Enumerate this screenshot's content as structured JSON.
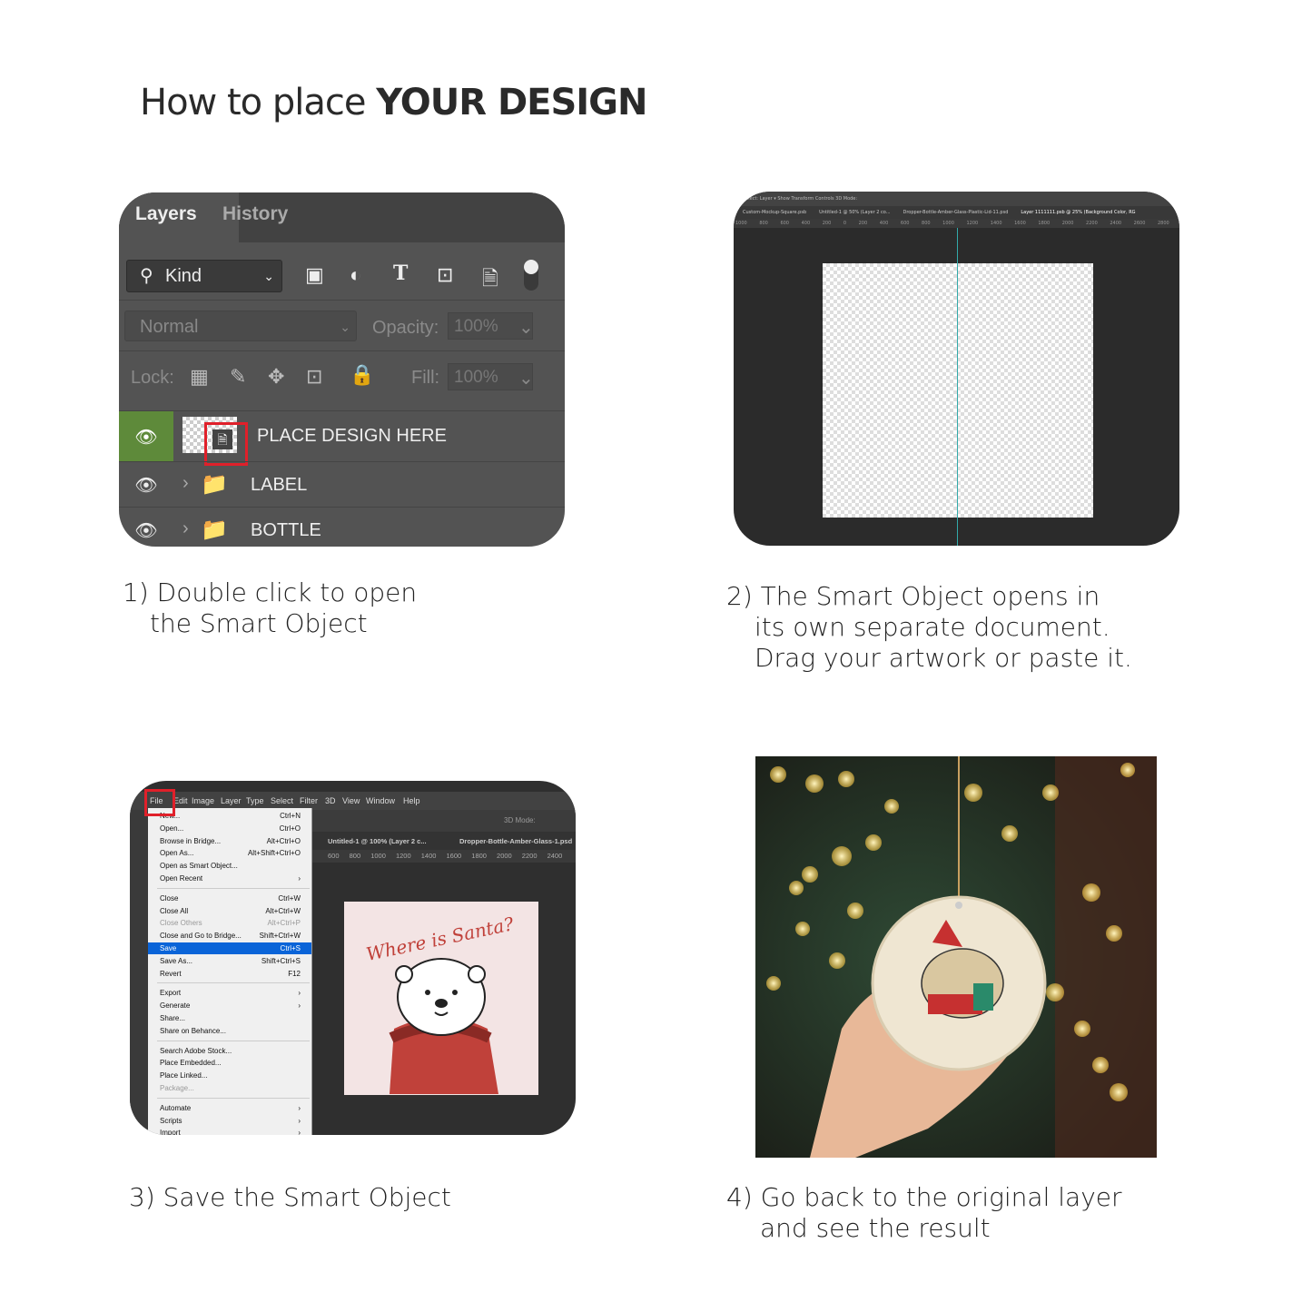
{
  "title": {
    "prefix": "How to place ",
    "emphasis": "YOUR DESIGN"
  },
  "steps": [
    {
      "lines": [
        "1) Double click to open",
        "the Smart Object"
      ]
    },
    {
      "lines": [
        "2) The Smart Object opens in",
        "its own separate document.",
        "Drag your artwork or paste it."
      ]
    },
    {
      "lines": [
        "3) Save the Smart Object"
      ]
    },
    {
      "lines": [
        "4) Go back to the original layer",
        "and see the result"
      ]
    }
  ],
  "layers_panel": {
    "tabs": [
      "Layers",
      "History"
    ],
    "filter_kind": "Kind",
    "blend_mode": "Normal",
    "opacity_label": "Opacity:",
    "opacity_value": "100%",
    "lock_label": "Lock:",
    "fill_label": "Fill:",
    "fill_value": "100%",
    "layers": [
      {
        "name": "PLACE DESIGN HERE",
        "visible": true,
        "type": "smart-object",
        "selected": true
      },
      {
        "name": "LABEL",
        "visible": true,
        "type": "group"
      },
      {
        "name": "BOTTLE",
        "visible": true,
        "type": "group"
      }
    ],
    "highlight_color": "#e0202a",
    "selected_color": "#5e8a3a"
  },
  "smart_object_doc": {
    "options_bar": "Select:  Layer  ▾   Show Transform Controls   3D Mode:",
    "tabs": [
      "Custom-Mockup-Square.psb",
      "Untitled-1 @ 50% (Layer 2 co...",
      "Dropper-Bottle-Amber-Glass-Plastic-Lid-11.psd",
      "Layer 1111111.psb @ 25% (Background Color, RG"
    ],
    "ruler": "1000 800 600 400 200 0 200 400 600 800 1000 1200 1400 1600 1800 2000 2200 2400 2600 2800 3000 3200 3400 3600 3800"
  },
  "file_menu": {
    "menubar": [
      "File",
      "Edit",
      "Image",
      "Layer",
      "Type",
      "Select",
      "Filter",
      "3D",
      "View",
      "Window",
      "Help"
    ],
    "options_bar": "3D Mode:",
    "tabs": [
      "Untitled-1 @ 100% (Layer 2 c...",
      "Dropper-Bottle-Amber-Glass-1.psd"
    ],
    "ruler": "600 800 1000 1200 1400 1600 1800 2000 2200 2400",
    "items": [
      {
        "label": "New...",
        "shortcut": "Ctrl+N"
      },
      {
        "label": "Open...",
        "shortcut": "Ctrl+O"
      },
      {
        "label": "Browse in Bridge...",
        "shortcut": "Alt+Ctrl+O"
      },
      {
        "label": "Open As...",
        "shortcut": "Alt+Shift+Ctrl+O"
      },
      {
        "label": "Open as Smart Object...",
        "shortcut": ""
      },
      {
        "label": "Open Recent",
        "shortcut": "›"
      },
      {
        "sep": true
      },
      {
        "label": "Close",
        "shortcut": "Ctrl+W"
      },
      {
        "label": "Close All",
        "shortcut": "Alt+Ctrl+W"
      },
      {
        "label": "Close Others",
        "shortcut": "Alt+Ctrl+P",
        "disabled": true
      },
      {
        "label": "Close and Go to Bridge...",
        "shortcut": "Shift+Ctrl+W"
      },
      {
        "label": "Save",
        "shortcut": "Ctrl+S",
        "selected": true
      },
      {
        "label": "Save As...",
        "shortcut": "Shift+Ctrl+S"
      },
      {
        "label": "Revert",
        "shortcut": "F12"
      },
      {
        "sep": true
      },
      {
        "label": "Export",
        "shortcut": "›"
      },
      {
        "label": "Generate",
        "shortcut": "›"
      },
      {
        "label": "Share...",
        "shortcut": ""
      },
      {
        "label": "Share on Behance...",
        "shortcut": ""
      },
      {
        "sep": true
      },
      {
        "label": "Search Adobe Stock...",
        "shortcut": ""
      },
      {
        "label": "Place Embedded...",
        "shortcut": ""
      },
      {
        "label": "Place Linked...",
        "shortcut": ""
      },
      {
        "label": "Package...",
        "shortcut": "",
        "disabled": true
      },
      {
        "sep": true
      },
      {
        "label": "Automate",
        "shortcut": "›"
      },
      {
        "label": "Scripts",
        "shortcut": "›"
      },
      {
        "label": "Import",
        "shortcut": "›"
      }
    ],
    "artwork_text": "Where is Santa?"
  }
}
